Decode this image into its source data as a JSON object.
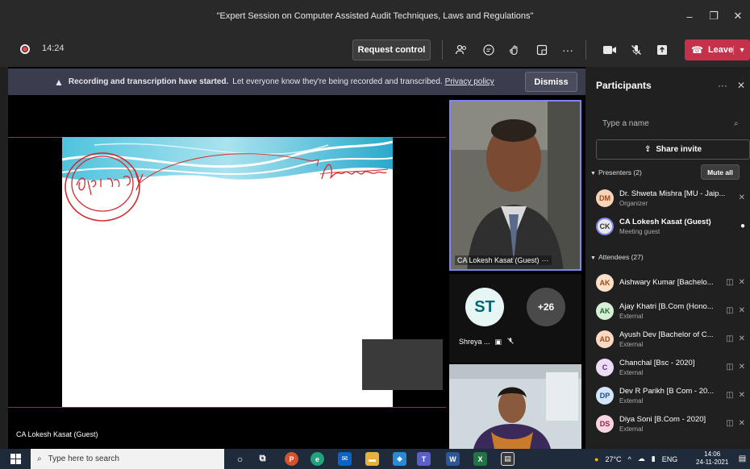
{
  "window": {
    "title": "\"Expert Session on Computer Assisted Audit Techniques, Laws and Regulations\"",
    "controls": [
      "–",
      "❐",
      "✕"
    ]
  },
  "toolbar": {
    "timer": "14:24",
    "request_control": "Request control",
    "leave": "Leave",
    "more": "···",
    "icons": [
      "people-icon",
      "chat-icon",
      "raise-hand-icon",
      "rooms-icon",
      "more-icon",
      "camera-icon",
      "mic-off-icon",
      "share-tray-icon"
    ]
  },
  "banner": {
    "bold": "Recording and transcription have started.",
    "text": "Let everyone know they're being recorded and transcribed.",
    "link": "Privacy policy",
    "dismiss": "Dismiss"
  },
  "stage": {
    "presenter": "CA Lokesh Kasat (Guest)"
  },
  "speaker_tile": {
    "label": "CA Lokesh Kasat (Guest)",
    "more": "···"
  },
  "mini_tiles": {
    "avatar": "ST",
    "name": "Shreya ...",
    "overflow": "+26"
  },
  "panel": {
    "title": "Participants",
    "search_placeholder": "Type a name",
    "share_invite": "Share invite",
    "presenters_label": "Presenters (2)",
    "mute_all": "Mute all",
    "attendees_label": "Attendees (27)",
    "presenters": [
      {
        "initials": "DM",
        "name": "Dr. Shweta Mishra [MU - Jaip...",
        "role": "Organizer",
        "bg": "#f6d4b8",
        "fg": "#a14a1a"
      },
      {
        "initials": "CK",
        "name": "CA Lokesh Kasat (Guest)",
        "role": "Meeting guest",
        "bg": "#e8e8e8",
        "fg": "#333333"
      }
    ],
    "attendees": [
      {
        "initials": "AK",
        "name": "Aishwary Kumar [Bachelo...",
        "role": "",
        "bg": "#fde1c8",
        "fg": "#9a4a12"
      },
      {
        "initials": "AK",
        "name": "Ajay Khatri [B.Com (Hono...",
        "role": "External",
        "bg": "#d6f0d6",
        "fg": "#2d6b2d"
      },
      {
        "initials": "AD",
        "name": "Ayush Dev [Bachelor of C...",
        "role": "External",
        "bg": "#fcd9c2",
        "fg": "#a84b1a"
      },
      {
        "initials": "C",
        "name": "Chanchal [Bsc - 2020]",
        "role": "External",
        "bg": "#ecdcf5",
        "fg": "#5b2c82"
      },
      {
        "initials": "DP",
        "name": "Dev R Parikh [B Com - 20...",
        "role": "External",
        "bg": "#d4e6fb",
        "fg": "#1b4f93"
      },
      {
        "initials": "DS",
        "name": "Diya Soni [B.Com - 2020]",
        "role": "External",
        "bg": "#f7d6e1",
        "fg": "#8c2448"
      }
    ]
  },
  "taskbar": {
    "search": "Type here to search",
    "weather": "27°C",
    "lang": "ENG",
    "time": "14:06",
    "date": "24-11-2021"
  }
}
